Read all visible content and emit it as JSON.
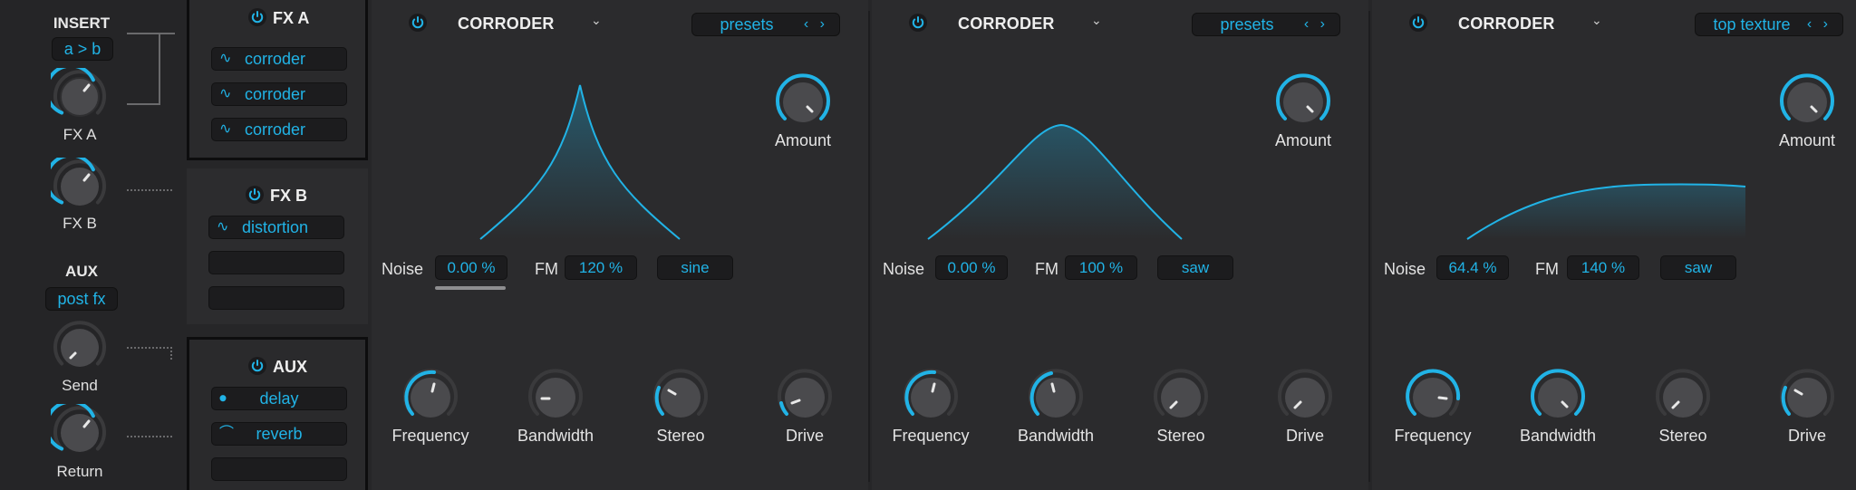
{
  "routing": {
    "insert_title": "INSERT",
    "insert_mode": "a > b",
    "fx_a_label": "FX A",
    "fx_b_label": "FX B",
    "aux_title": "AUX",
    "aux_mode": "post fx",
    "send_label": "Send",
    "return_label": "Return"
  },
  "slots": {
    "fx_a": {
      "name": "FX A",
      "items": [
        "corroder",
        "corroder",
        "corroder"
      ]
    },
    "fx_b": {
      "name": "FX B",
      "items": [
        "distortion",
        "",
        ""
      ]
    },
    "aux": {
      "name": "AUX",
      "items": [
        "delay",
        "reverb",
        ""
      ]
    }
  },
  "panels": [
    {
      "title": "CORRODER",
      "preset": "presets",
      "amount_label": "Amount",
      "noise_label": "Noise",
      "noise_value": "0.00 %",
      "fm_label": "FM",
      "fm_value": "120 %",
      "wave_value": "sine",
      "knobs": [
        "Frequency",
        "Bandwidth",
        "Stereo",
        "Drive"
      ]
    },
    {
      "title": "CORRODER",
      "preset": "presets",
      "amount_label": "Amount",
      "noise_label": "Noise",
      "noise_value": "0.00 %",
      "fm_label": "FM",
      "fm_value": "100 %",
      "wave_value": "saw",
      "knobs": [
        "Frequency",
        "Bandwidth",
        "Stereo",
        "Drive"
      ]
    },
    {
      "title": "CORRODER",
      "preset": "top texture",
      "amount_label": "Amount",
      "noise_label": "Noise",
      "noise_value": "64.4 %",
      "fm_label": "FM",
      "fm_value": "140 %",
      "wave_value": "saw",
      "knobs": [
        "Frequency",
        "Bandwidth",
        "Stereo",
        "Drive"
      ]
    }
  ],
  "colors": {
    "accent": "#21b3e6",
    "background": "#2b2b2d",
    "field": "#1c1c1e"
  },
  "icons": {
    "power": "power-icon",
    "chevron": "chevron-down-icon",
    "prev_next": "prev-next-arrows-icon",
    "wave": "wave-icon"
  }
}
